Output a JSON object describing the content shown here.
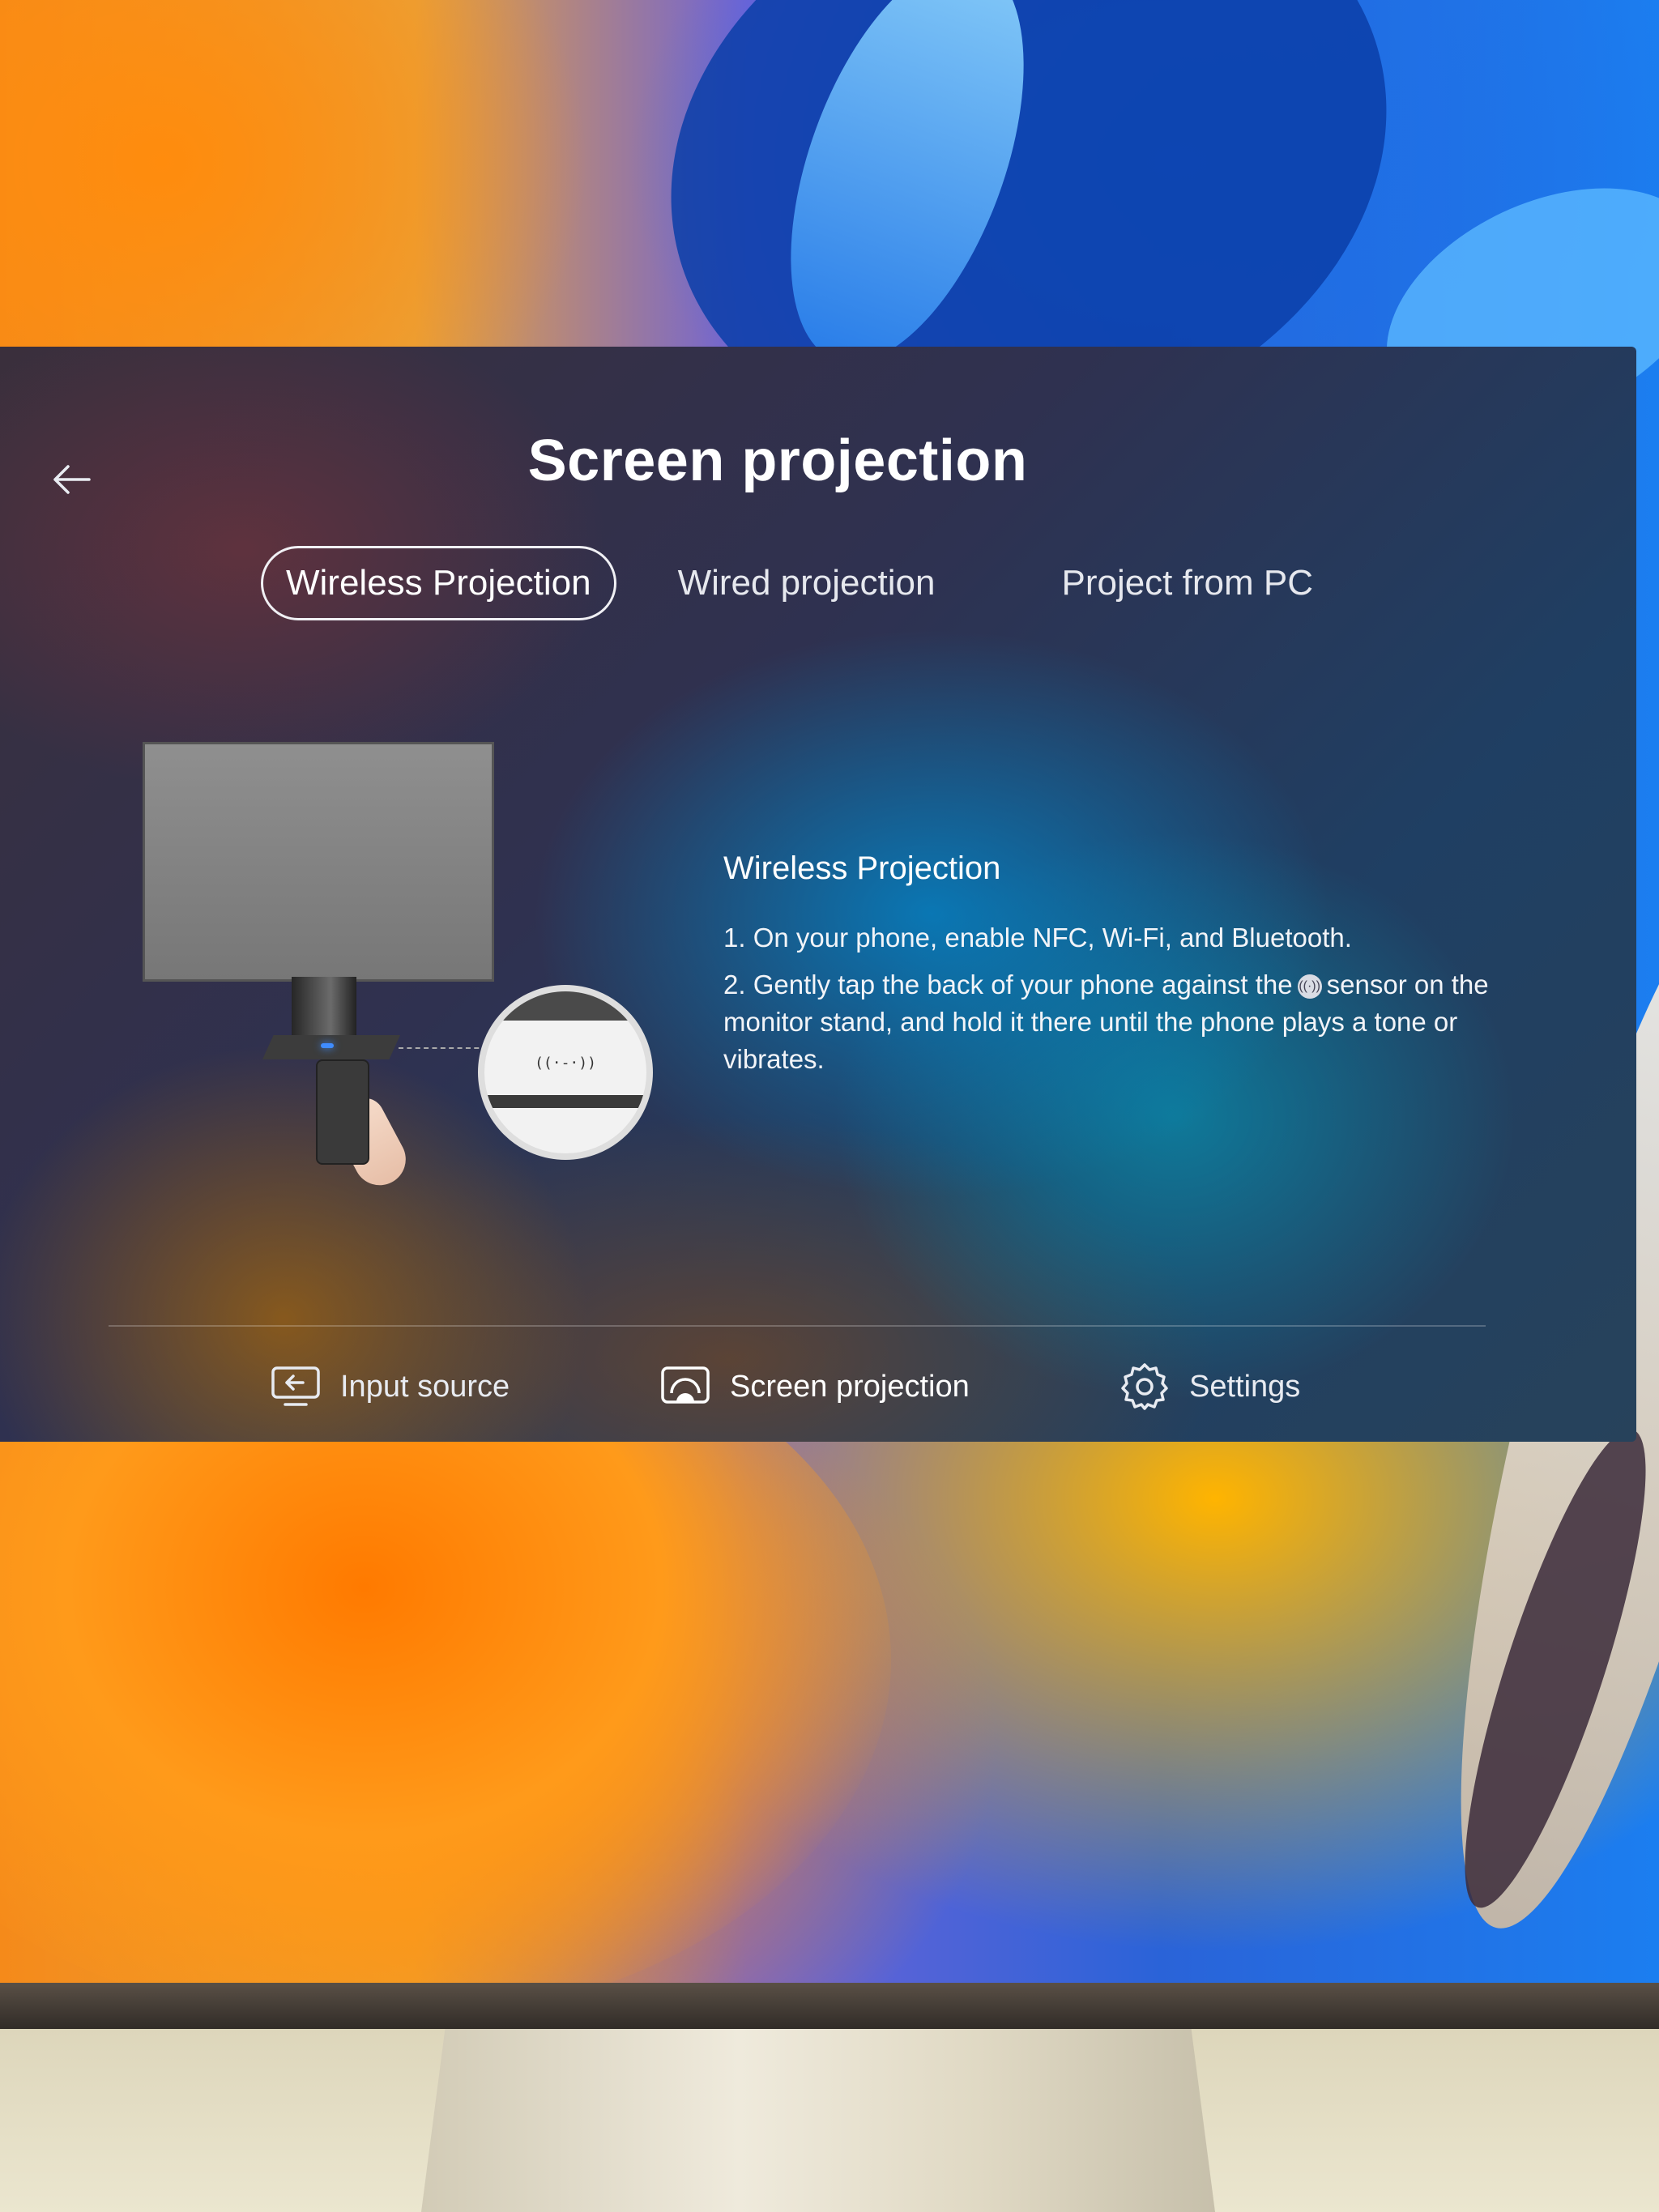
{
  "header": {
    "title": "Screen projection",
    "back_icon": "arrow-left-icon"
  },
  "tabs": [
    {
      "label": "Wireless Projection",
      "active": true
    },
    {
      "label": "Wired projection",
      "active": false
    },
    {
      "label": "Project from PC",
      "active": false
    }
  ],
  "illustration": {
    "zoom_glyph": "((·-·))"
  },
  "instructions": {
    "title": "Wireless Projection",
    "step1": "1. On your phone, enable NFC, Wi-Fi, and Bluetooth.",
    "step2_before": "2. Gently tap the back of your phone against the",
    "step2_icon": "nfc-icon",
    "step2_after": "sensor on the monitor stand, and hold it there until the phone plays a tone or vibrates."
  },
  "bottom_nav": [
    {
      "label": "Input source",
      "icon": "input-source-icon",
      "active": false
    },
    {
      "label": "Screen projection",
      "icon": "screen-projection-icon",
      "active": true
    },
    {
      "label": "Settings",
      "icon": "gear-icon",
      "active": false
    }
  ],
  "colors": {
    "text": "#ffffff",
    "tab_outline": "#f0f0f4",
    "led": "#3f8cff"
  }
}
